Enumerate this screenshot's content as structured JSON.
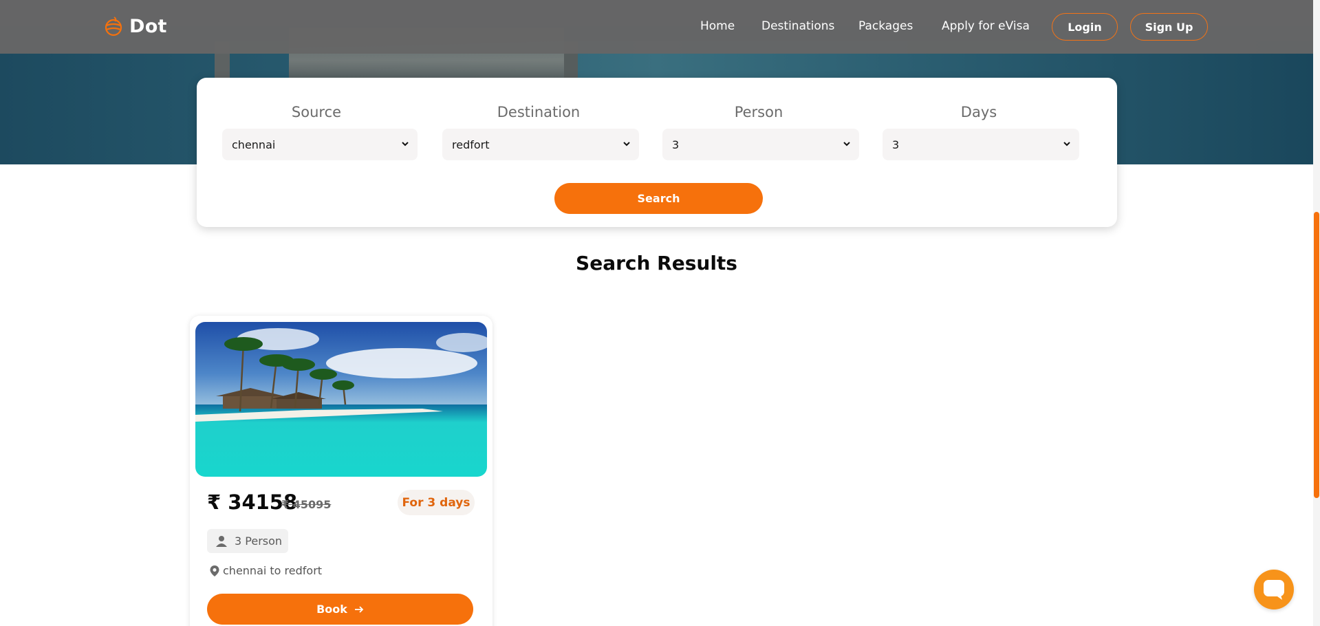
{
  "brand": {
    "name": "Dot",
    "accent": "#f6710c"
  },
  "nav": {
    "links": [
      "Home",
      "Destinations",
      "Packages",
      "Apply for eVisa"
    ],
    "login": "Login",
    "signup": "Sign Up"
  },
  "search": {
    "fields": [
      {
        "label": "Source",
        "value": "chennai"
      },
      {
        "label": "Destination",
        "value": "redfort"
      },
      {
        "label": "Person",
        "value": "3"
      },
      {
        "label": "Days",
        "value": "3"
      }
    ],
    "button": "Search"
  },
  "results": {
    "title": "Search Results",
    "items": [
      {
        "price_now": "₹ 34158",
        "price_old": "₹ 45095",
        "days": "For 3 days",
        "persons": "3 Person",
        "route": "chennai to redfort",
        "book": "Book"
      }
    ]
  },
  "icons": {
    "logo": "globe-logo-icon",
    "chevron": "chevron-down-icon",
    "person": "person-icon",
    "location": "location-pin-icon",
    "arrow": "arrow-right-icon",
    "chat": "chat-icon"
  }
}
